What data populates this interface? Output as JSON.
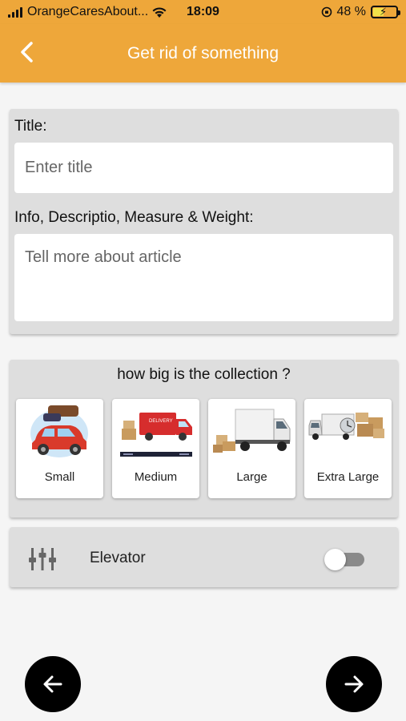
{
  "status_bar": {
    "carrier": "OrangeCaresAbout...",
    "time": "18:09",
    "battery_percent": "48 %",
    "battery_level": 0.48
  },
  "header": {
    "title": "Get rid of something",
    "background_color": "#eea73a"
  },
  "form": {
    "title_label": "Title:",
    "title_placeholder": "Enter title",
    "title_value": "",
    "description_label": "Info, Descriptio, Measure & Weight:",
    "description_placeholder": "Tell more about article",
    "description_value": ""
  },
  "collection_size": {
    "question": "how big is the collection ?",
    "options": [
      {
        "label": "Small",
        "image": "car-with-luggage"
      },
      {
        "label": "Medium",
        "image": "delivery-van"
      },
      {
        "label": "Large",
        "image": "box-truck"
      },
      {
        "label": "Extra Large",
        "image": "truck-with-boxes"
      }
    ]
  },
  "elevator": {
    "label": "Elevator",
    "icon": "equalizer-sliders-icon",
    "enabled": false
  },
  "navigation": {
    "prev_icon": "arrow-left-icon",
    "next_icon": "arrow-right-icon"
  }
}
